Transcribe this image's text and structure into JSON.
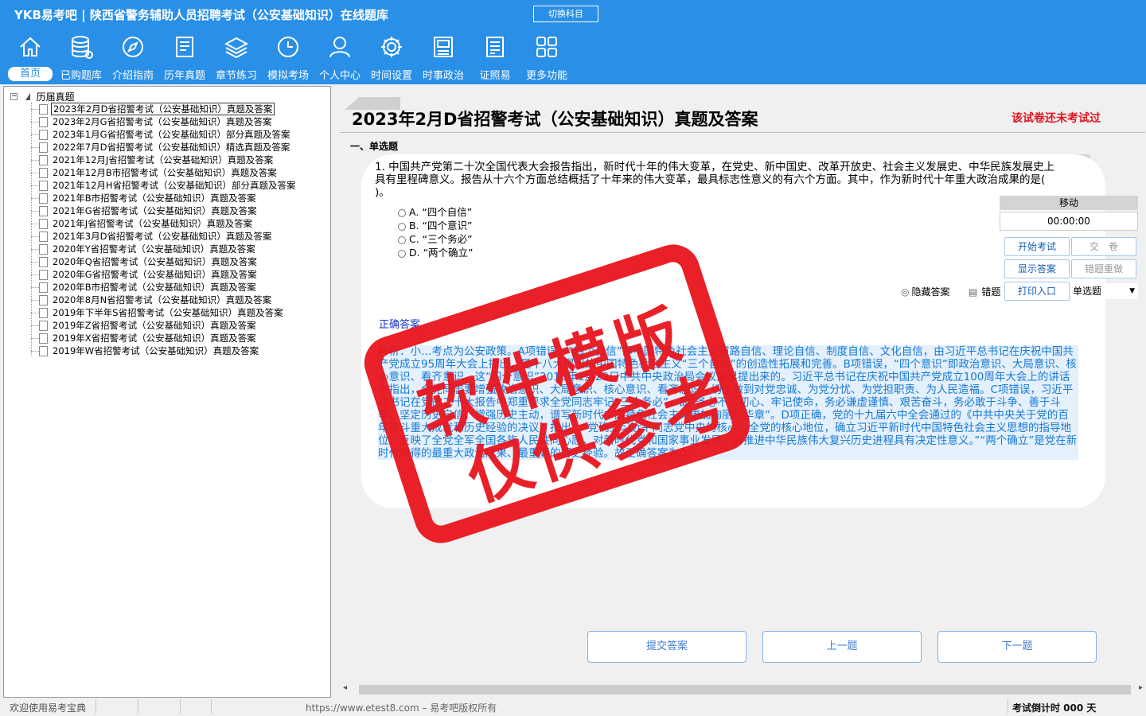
{
  "header": {
    "title": "YKB易考吧 | 陕西省警务辅助人员招聘考试（公安基础知识）在线题库",
    "switch_label": "切换科目"
  },
  "nav": [
    {
      "label": "首页",
      "icon": "home-icon"
    },
    {
      "label": "已购题库",
      "icon": "database-icon"
    },
    {
      "label": "介绍指南",
      "icon": "compass-icon"
    },
    {
      "label": "历年真题",
      "icon": "document-icon"
    },
    {
      "label": "章节练习",
      "icon": "layers-icon"
    },
    {
      "label": "模拟考场",
      "icon": "clock-icon"
    },
    {
      "label": "个人中心",
      "icon": "user-icon"
    },
    {
      "label": "时间设置",
      "icon": "gear-icon"
    },
    {
      "label": "时事政治",
      "icon": "news-icon"
    },
    {
      "label": "证照易",
      "icon": "certificate-icon"
    },
    {
      "label": "更多功能",
      "icon": "grid-icon"
    }
  ],
  "tree": {
    "root": "历届真题",
    "items": [
      "2023年2月D省招警考试（公安基础知识）真题及答案",
      "2023年2月G省招警考试（公安基础知识）真题及答案",
      "2023年1月G省招警考试（公安基础知识）部分真题及答案",
      "2022年7月D省招警考试（公安基础知识）精选真题及答案",
      "2021年12月J省招警考试（公安基础知识）真题及答案",
      "2021年12月B市招警考试（公安基础知识）真题及答案",
      "2021年12月H省招警考试（公安基础知识）部分真题及答案",
      "2021年B市招警考试（公安基础知识）真题及答案",
      "2021年G省招警考试（公安基础知识）真题及答案",
      "2021年J省招警考试（公安基础知识）真题及答案",
      "2021年3月D省招警考试（公安基础知识）真题及答案",
      "2020年Y省招警考试（公安基础知识）真题及答案",
      "2020年Q省招警考试（公安基础知识）真题及答案",
      "2020年G省招警考试（公安基础知识）真题及答案",
      "2020年B市招警考试（公安基础知识）真题及答案",
      "2020年8月N省招警考试（公安基础知识）真题及答案",
      "2019年下半年S省招警考试（公安基础知识）真题及答案",
      "2019年Z省招警考试（公安基础知识）真题及答案",
      "2019年X省招警考试（公安基础知识）真题及答案",
      "2019年W省招警考试（公安基础知识）真题及答案"
    ]
  },
  "exam": {
    "title": "2023年2月D省招警考试（公安基础知识）真题及答案",
    "status": "该试卷还未考试过",
    "section": "一、单选题",
    "question": "1. 中国共产党第二十次全国代表大会报告指出，新时代十年的伟大变革，在党史、新中国史、改革开放史、社会主义发展史、中华民族发展史上具有里程碑意义。报告从十六个方面总结概括了十年来的伟大变革，最具标志性意义的有六个方面。其中，作为新时代十年重大政治成果的是( )。",
    "options": [
      "A. “四个自信”",
      "B. “四个意识”",
      "C. “三个务必”",
      "D. “两个确立”"
    ],
    "hide_answer_label": "隐藏答案",
    "wrong_book_label": "错题",
    "answer_label": "正确答案",
    "analysis": "解析：小…考点为公安政策。A项错误，“四个自信”即中国特色社会主义道路自信、理论自信、制度自信、文化自信，由习近平总书记在庆祝中国共产党成立95周年大会上提出，是十八大提出的中国特色社会主义“三个自信”的创造性拓展和完善。B项错误，“四个意识”即政治意识、大局意识、核心意识、看齐意识。这“四个意识”2016年1月29日中共中央政治局会议最早提出来的。习近平总书记在庆祝中国共产党成立100周年大会上的讲话中指出，全党同志要增强政治意识、大局意识、核心意识、看齐意识，切实做到对党忠诚、为党分忧、为党担职责、为人民造福。C项错误，习近平总书记在党的二十大报告中郑重要求全党同志牢记“三个务必”，即“务必不忘初心、牢记使命，务必谦虚谨慎、艰苦奋斗，务必敢于斗争、善于斗争，坚定历史自信，增强历史主动，谱写新时代中国特色社会主义更加绚丽的华章”。D项正确，党的十九届六中全会通过的《中共中央关于党的百年奋斗重大成就和历史经验的决议》指出：“党确立习近平同志党中央的核心、全党的核心地位，确立习近平新时代中国特色社会主义思想的指导地位，反映了全党全军全国各族人民共同心愿，对新时代党和国家事业发展、对推进中华民族伟大复兴历史进程具有决定性意义。”“两个确立”是党在新时代取得的最重大政治成果、最重要的历史经验。故正确答案为D。"
  },
  "panel": {
    "move_label": "移动",
    "timer": "00:00:00",
    "start_label": "开始考试",
    "submit_paper_label": "交　卷",
    "show_answer_label": "显示答案",
    "redo_wrong_label": "错题重做",
    "print_label": "打印入口",
    "qtype_value": "单选题"
  },
  "buttons": {
    "submit_answer": "提交答案",
    "prev": "上一题",
    "next": "下一题"
  },
  "status": {
    "welcome": "欢迎使用易考宝典",
    "copyright": "https://www.etest8.com – 易考吧版权所有",
    "countdown": "考试倒计时 000 天"
  },
  "watermark": {
    "line1": "软件模版",
    "line2": "仅供参考"
  }
}
